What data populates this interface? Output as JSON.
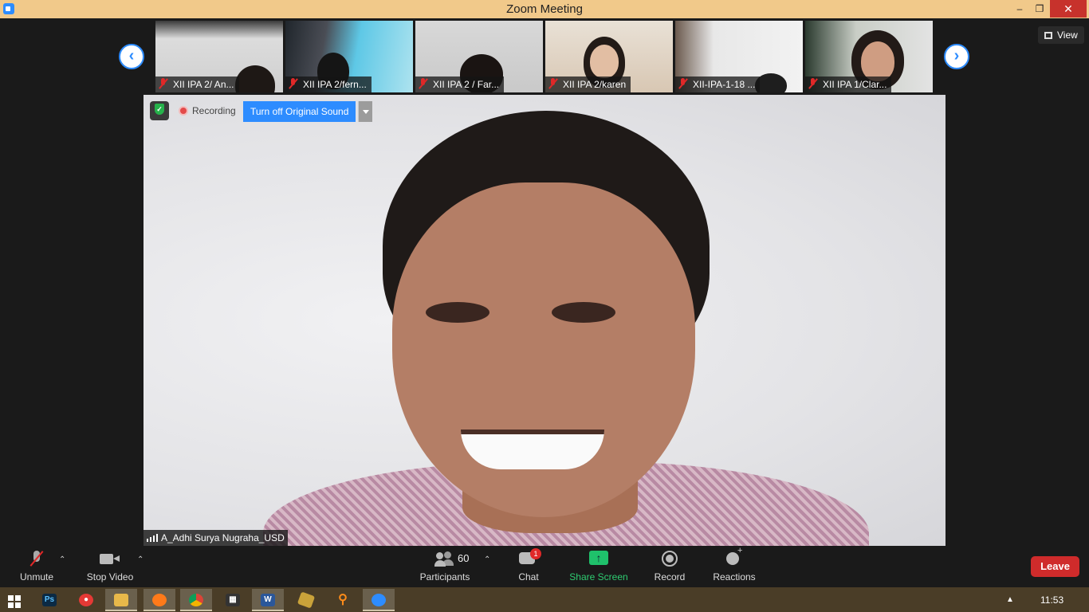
{
  "window": {
    "title": "Zoom Meeting",
    "minimize": "–",
    "maximize": "❐",
    "close": "✕"
  },
  "gallery": {
    "prev_arrow": "‹",
    "next_arrow": "›",
    "view_button": "View",
    "participants": [
      {
        "label": "XII IPA 2/ An...",
        "muted": true
      },
      {
        "label": "XII IPA 2/fern...",
        "muted": true
      },
      {
        "label": "XII IPA 2 / Far...",
        "muted": true
      },
      {
        "label": "XII IPA 2/karen",
        "muted": true
      },
      {
        "label": "XII-IPA-1-18 ...",
        "muted": true
      },
      {
        "label": "XII IPA 1/Clar...",
        "muted": true
      }
    ]
  },
  "main_video": {
    "recording_label": "Recording",
    "original_sound_button": "Turn off Original Sound",
    "speaker_name": "A_Adhi Surya Nugraha_USD"
  },
  "toolbar": {
    "unmute": "Unmute",
    "stop_video": "Stop Video",
    "participants_label": "Participants",
    "participants_count": "60",
    "chat": "Chat",
    "chat_badge": "1",
    "share_screen": "Share Screen",
    "record": "Record",
    "reactions": "Reactions",
    "leave": "Leave",
    "colors": {
      "accent": "#2d8cff",
      "share": "#1fc16b",
      "leave": "#cf2b2b"
    }
  },
  "taskbar": {
    "apps": [
      "windows-start",
      "photoshop",
      "screen-recorder",
      "file-explorer",
      "firefox",
      "chrome",
      "video-editor",
      "word",
      "tool",
      "search-tool",
      "zoom"
    ],
    "tray_caret": "▲",
    "clock": "11:53"
  }
}
